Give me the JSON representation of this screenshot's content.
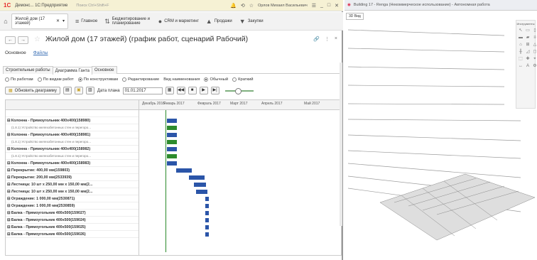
{
  "titlebar": {
    "logo": "1С",
    "app_text": "Демонс... 1С:Предприятие",
    "search_placeholder": "Поиск Ctrl+Shift+F",
    "user": "Орлов Михаил Васильевич"
  },
  "navbar": {
    "tab_title": "Жилой дом (17 этажей)",
    "sections": [
      {
        "label": "Главное",
        "icon": "menu-icon"
      },
      {
        "label": "Бюджетирование и планирование",
        "icon": "budget-icon"
      },
      {
        "label": "CRM и маркетинг",
        "icon": "crm-icon"
      },
      {
        "label": "Продажи",
        "icon": "sales-icon"
      },
      {
        "label": "Закупки",
        "icon": "purchases-icon"
      }
    ]
  },
  "doc": {
    "title": "Жилой дом (17 этажей)  (график работ, сценарий Рабочий)",
    "links": {
      "main": "Основное",
      "files": "Файлы"
    },
    "tabs": [
      "Строительные работы",
      "Диаграмма Ганта",
      "Основное"
    ],
    "active_tab": "Диаграмма Ганта",
    "radios": [
      {
        "label": "По работам",
        "on": false
      },
      {
        "label": "По видам работ",
        "on": false
      },
      {
        "label": "По конструктивам",
        "on": true
      },
      {
        "label": "Редактирование",
        "on": false
      },
      {
        "label": "Вид наименования",
        "on": null
      },
      {
        "label": "Обычный",
        "on": true
      },
      {
        "label": "Краткий",
        "on": false
      }
    ],
    "toolbar": {
      "refresh_label": "Обновить диаграмму",
      "date_label": "Дата плана",
      "date_value": "01.01.2017"
    }
  },
  "gantt": {
    "months": [
      "Декабрь 2016",
      "Январь 2017",
      "Февраль 2017",
      "Март 2017",
      "Апрель 2017",
      "Май 2017"
    ],
    "rows": [
      {
        "label": "",
        "kind": "blank"
      },
      {
        "label": "⊟ Колонна - Прямоугольник 400х400(158980)",
        "kind": "bold",
        "bars": [
          {
            "start": 0.6,
            "len": 0.3,
            "color": "#2b55a8"
          }
        ]
      },
      {
        "label": "(1.8.1) Устройство железобетонных стен и перегоро...",
        "kind": "sub",
        "bars": [
          {
            "start": 0.6,
            "len": 0.3,
            "color": "#2d8b2d"
          }
        ]
      },
      {
        "label": "⊟ Колонна - Прямоугольник 400х400(158981)",
        "kind": "bold",
        "bars": [
          {
            "start": 0.6,
            "len": 0.3,
            "color": "#2b55a8"
          }
        ]
      },
      {
        "label": "(1.8.1) Устройство железобетонных стен и перегоро...",
        "kind": "sub",
        "bars": [
          {
            "start": 0.6,
            "len": 0.3,
            "color": "#2d8b2d"
          }
        ]
      },
      {
        "label": "⊟ Колонна - Прямоугольник 400х400(158982)",
        "kind": "bold",
        "bars": [
          {
            "start": 0.6,
            "len": 0.3,
            "color": "#2b55a8"
          }
        ]
      },
      {
        "label": "(1.8.1) Устройство железобетонных стен и перегоро...",
        "kind": "sub",
        "bars": [
          {
            "start": 0.6,
            "len": 0.3,
            "color": "#2d8b2d"
          }
        ]
      },
      {
        "label": "⊟ Колонна - Прямоугольник 400х400(158983)",
        "kind": "bold",
        "bars": [
          {
            "start": 0.6,
            "len": 0.3,
            "color": "#2b55a8"
          }
        ]
      },
      {
        "label": "⊟ Перекрытие: 400,00 мм(159803)",
        "kind": "bold",
        "bars": [
          {
            "start": 0.88,
            "len": 0.45,
            "color": "#2b55a8"
          }
        ]
      },
      {
        "label": "⊟ Перекрытие: 200,00 мм(2533939)",
        "kind": "bold",
        "bars": [
          {
            "start": 1.25,
            "len": 0.45,
            "color": "#2b55a8"
          }
        ]
      },
      {
        "label": "⊟ Лестница: 10 шт х 250,00 мм х 150,00 мм(2...",
        "kind": "bold",
        "bars": [
          {
            "start": 1.4,
            "len": 0.35,
            "color": "#2b55a8"
          }
        ]
      },
      {
        "label": "⊟ Лестница: 10 шт х 250,00 мм х 150,00 мм(2...",
        "kind": "bold",
        "bars": [
          {
            "start": 1.45,
            "len": 0.35,
            "color": "#2b55a8"
          }
        ]
      },
      {
        "label": "⊟ Ограждение: 1 000,00 мм(2530871)",
        "kind": "bold",
        "bars": [
          {
            "start": 1.72,
            "len": 0.12,
            "color": "#2b55a8"
          }
        ]
      },
      {
        "label": "⊟ Ограждение: 1 000,00 мм(2530859)",
        "kind": "bold",
        "bars": [
          {
            "start": 1.72,
            "len": 0.12,
            "color": "#2b55a8"
          }
        ]
      },
      {
        "label": "⊟ Балка - Прямоугольник 400х500(159027)",
        "kind": "bold",
        "bars": [
          {
            "start": 1.72,
            "len": 0.12,
            "color": "#2b55a8"
          }
        ]
      },
      {
        "label": "⊟ Балка - Прямоугольник 400х500(159024)",
        "kind": "bold",
        "bars": [
          {
            "start": 1.72,
            "len": 0.12,
            "color": "#2b55a8"
          }
        ]
      },
      {
        "label": "⊟ Балка - Прямоугольник 400х500(159025)",
        "kind": "bold",
        "bars": [
          {
            "start": 1.72,
            "len": 0.12,
            "color": "#2b55a8"
          }
        ]
      },
      {
        "label": "⊟ Балка - Прямоугольник 400х500(159026)",
        "kind": "bold",
        "bars": [
          {
            "start": 1.72,
            "len": 0.12,
            "color": "#2b55a8"
          }
        ]
      }
    ]
  },
  "renga": {
    "title": "Building 17 - Renga (Некоммерческое использование) - Автономная работа",
    "view_tab": "3D Вид",
    "instruments_title": "Инструменты"
  }
}
